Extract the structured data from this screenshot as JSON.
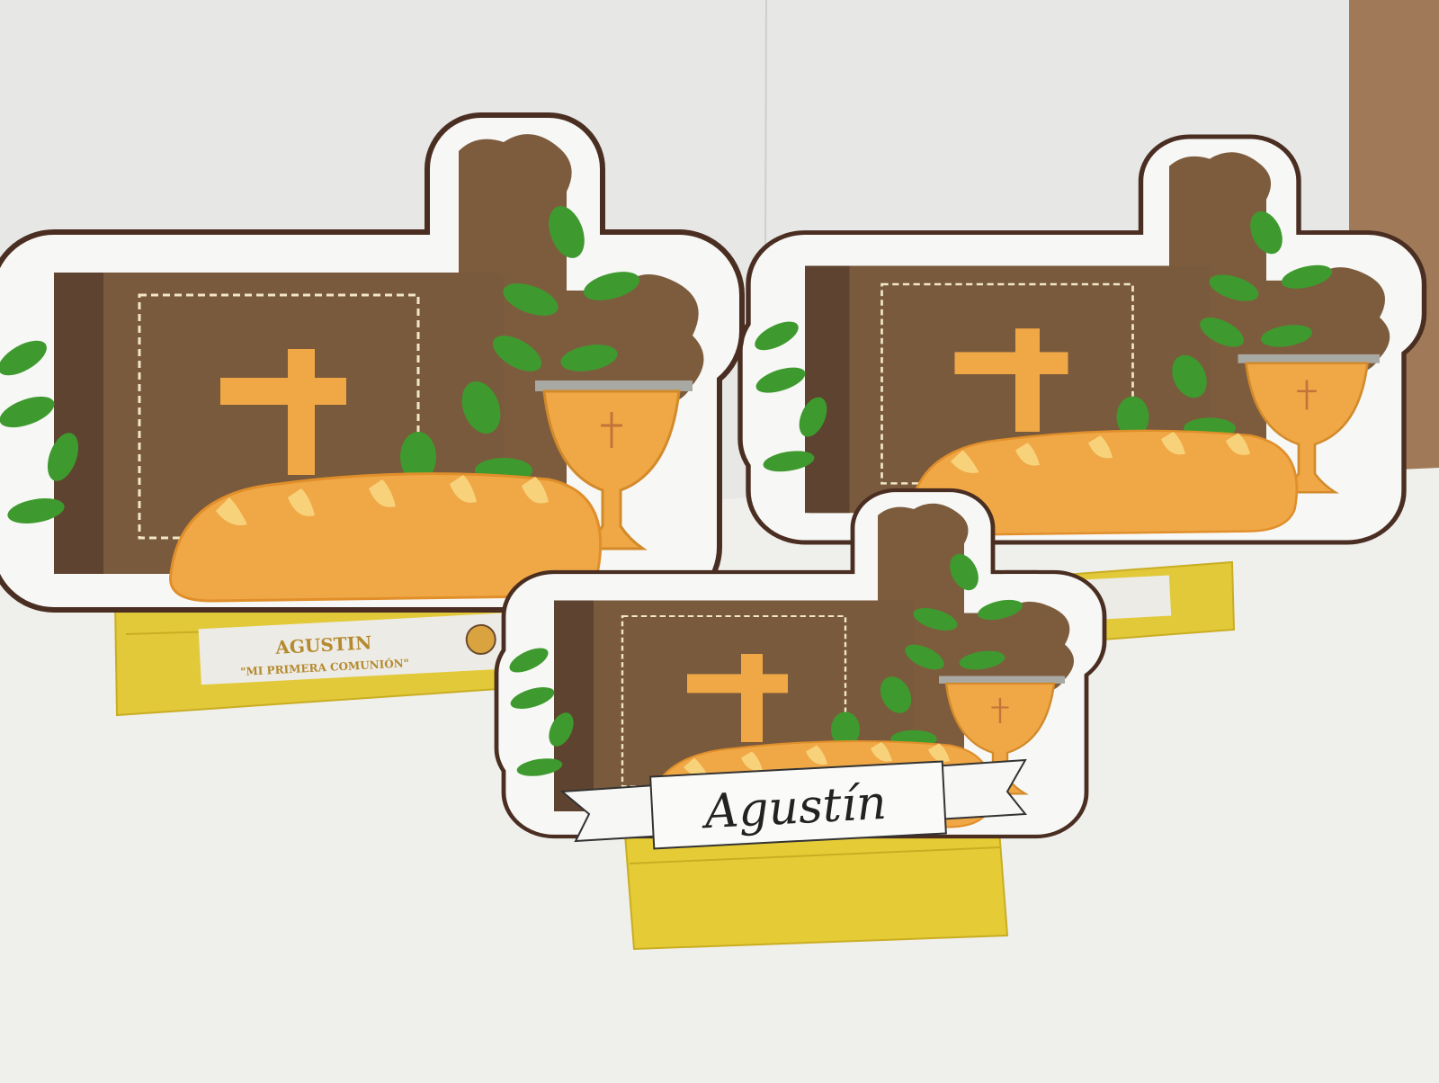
{
  "photo": {
    "subject": "first communion wooden centerpieces",
    "colors": {
      "wall": "#e8e8e6",
      "table": "#efefec",
      "base": "#e2c93a",
      "book": "#7a5a3c",
      "cross": "#7d5c3e",
      "gold": "#f0a847",
      "leaf": "#3e9a2e",
      "outline": "#4a2e22"
    }
  },
  "labels": {
    "left_name": "AGUSTIN",
    "left_subtitle": "\"MI PRIMERA COMUNIÓN\"",
    "front_banner": "Agustín"
  }
}
